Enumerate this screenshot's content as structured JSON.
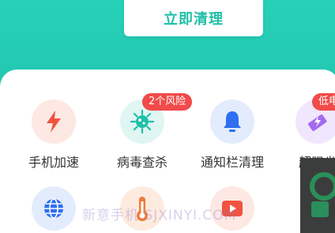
{
  "header": {
    "clean_button_label": "立即清理"
  },
  "tools": [
    {
      "label": "手机加速",
      "icon": "lightning-icon",
      "color": "#f0533f",
      "bg": "#fde8e4"
    },
    {
      "label": "病毒查杀",
      "icon": "virus-icon",
      "color": "#1fbfa8",
      "bg": "#dff6f3",
      "badge": "2个风险"
    },
    {
      "label": "通知栏清理",
      "icon": "bell-icon",
      "color": "#2f6ff0",
      "bg": "#e3ecfd"
    },
    {
      "label": "超强省",
      "icon": "battery-bolt-icon",
      "color": "#a36af0",
      "bg": "#f0e6fd",
      "badge": "低电"
    },
    {
      "label": "",
      "icon": "globe-icon",
      "color": "#2f6ff0",
      "bg": "#e3ecfd"
    },
    {
      "label": "",
      "icon": "thermometer-icon",
      "color": "#f07b3a",
      "bg": "#fdebe0"
    },
    {
      "label": "",
      "icon": "video-play-icon",
      "color": "#f0533f",
      "bg": "#fde8e4"
    }
  ],
  "watermark": "新意手机  SJXINYI.COM"
}
